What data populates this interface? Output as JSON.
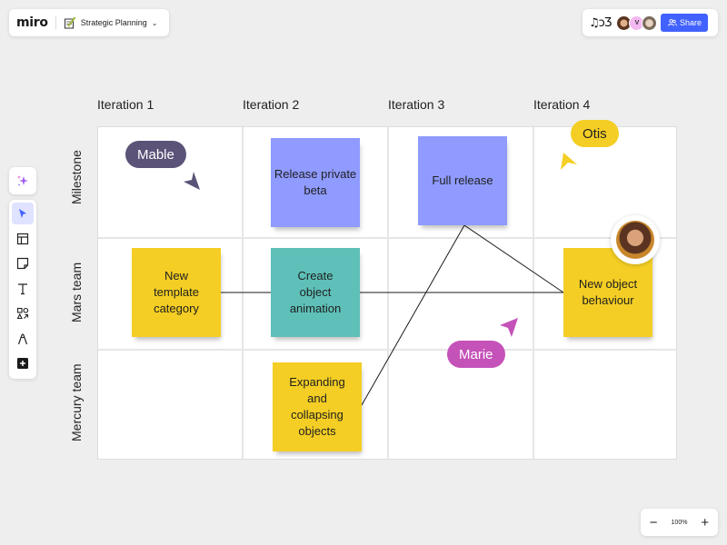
{
  "app": {
    "logo": "miro",
    "board_title": "Strategic Planning",
    "board_icon": "notepad-pencil-icon"
  },
  "topright": {
    "reactions": "♫ͻƷ",
    "avatars": [
      {
        "name": "user-1",
        "initial": "",
        "color": "#8b5a2b"
      },
      {
        "name": "user-v",
        "initial": "V",
        "color": "#f4b8f0"
      },
      {
        "name": "user-3",
        "initial": "",
        "color": "#c9b49e"
      }
    ],
    "share_label": "Share"
  },
  "toolbar": {
    "ai": "sparkles-icon",
    "tools": [
      "select",
      "templates",
      "sticky-note",
      "text",
      "shapes",
      "pen",
      "more"
    ]
  },
  "zoom": {
    "minus": "−",
    "value": "100%",
    "plus": "+"
  },
  "board": {
    "columns": [
      "Iteration 1",
      "Iteration 2",
      "Iteration 3",
      "Iteration 4"
    ],
    "rows": [
      "Milestone",
      "Mars team",
      "Mercury team"
    ],
    "stickies": [
      {
        "id": "release-private-beta",
        "text": "Release private beta",
        "color": "blue"
      },
      {
        "id": "full-release",
        "text": "Full release",
        "color": "blue"
      },
      {
        "id": "new-template-category",
        "text": "New template category",
        "color": "yellow"
      },
      {
        "id": "create-object-animation",
        "text": "Create object animation",
        "color": "teal"
      },
      {
        "id": "new-object-behaviour",
        "text": "New object behaviour",
        "color": "yellow"
      },
      {
        "id": "expanding-collapsing-objects",
        "text": "Expanding and collapsing objects",
        "color": "yellow"
      }
    ],
    "cursors": [
      {
        "name": "Mable",
        "color": "#5b5378",
        "text_color": "#ffffff"
      },
      {
        "name": "Otis",
        "color": "#f4ce24",
        "text_color": "#1f1f1f"
      },
      {
        "name": "Marie",
        "color": "#c552b9",
        "text_color": "#ffffff"
      }
    ]
  },
  "colors": {
    "accent": "#4262ff",
    "sticky_yellow": "#f4ce24",
    "sticky_blue": "#8f9bff",
    "sticky_teal": "#5ec0b8"
  }
}
